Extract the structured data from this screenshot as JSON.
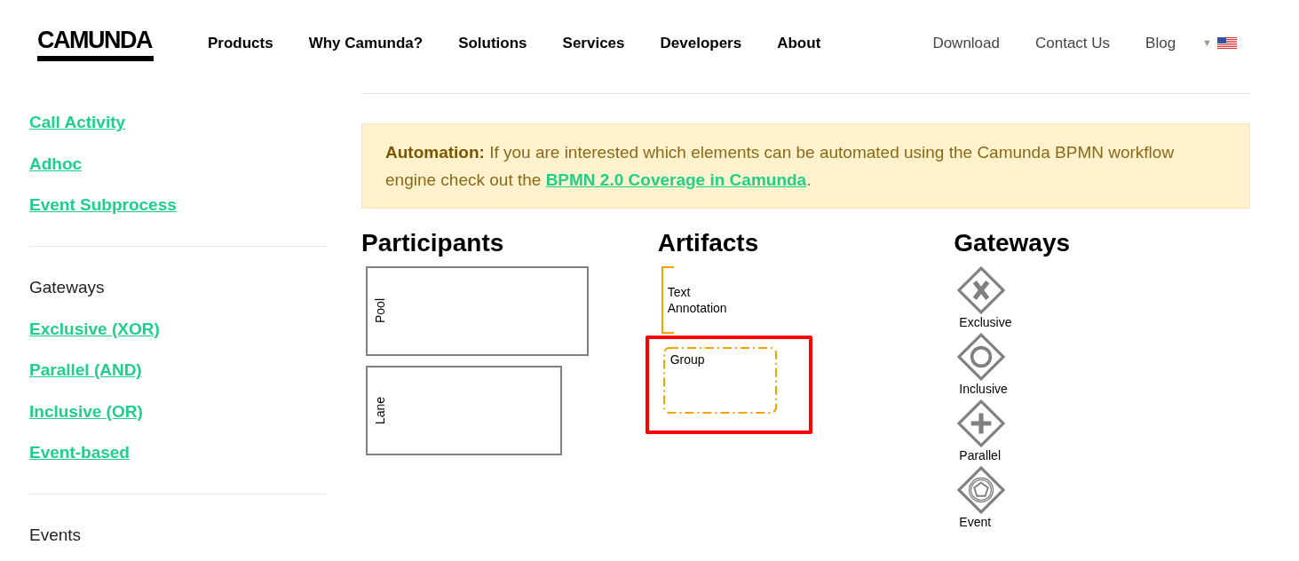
{
  "header": {
    "logo": "CAMUNDA",
    "nav": [
      "Products",
      "Why Camunda?",
      "Solutions",
      "Services",
      "Developers",
      "About"
    ],
    "links": [
      "Download",
      "Contact Us",
      "Blog"
    ],
    "language_caret": "▼"
  },
  "sidebar": {
    "items": [
      {
        "kind": "link",
        "label": "Call Activity"
      },
      {
        "kind": "link",
        "label": "Adhoc"
      },
      {
        "kind": "link",
        "label": "Event Subprocess"
      },
      {
        "kind": "divider"
      },
      {
        "kind": "heading",
        "label": "Gateways"
      },
      {
        "kind": "link",
        "label": "Exclusive (XOR)"
      },
      {
        "kind": "link",
        "label": "Parallel (AND)"
      },
      {
        "kind": "link",
        "label": "Inclusive (OR)"
      },
      {
        "kind": "link",
        "label": "Event-based"
      },
      {
        "kind": "divider"
      },
      {
        "kind": "heading",
        "label": "Events"
      }
    ]
  },
  "notice": {
    "label": "Automation:",
    "text": "If you are interested which elements can be automated using the Camunda BPMN workflow engine check out the",
    "link": "BPMN 2.0 Coverage in Camunda",
    "end": "."
  },
  "columns": [
    {
      "title": "Participants",
      "items": [
        {
          "kind": "pool",
          "label": "Pool"
        },
        {
          "kind": "lane",
          "label": "Lane"
        }
      ]
    },
    {
      "title": "Artifacts",
      "items": [
        {
          "kind": "annotation",
          "label": "Text Annotation"
        },
        {
          "kind": "group",
          "label": "Group",
          "highlighted": true
        }
      ]
    },
    {
      "title": "Gateways",
      "items": [
        {
          "kind": "exclusive",
          "label": "Exclusive"
        },
        {
          "kind": "inclusive",
          "label": "Inclusive"
        },
        {
          "kind": "parallel",
          "label": "Parallel"
        },
        {
          "kind": "event",
          "label": "Event"
        }
      ]
    }
  ]
}
